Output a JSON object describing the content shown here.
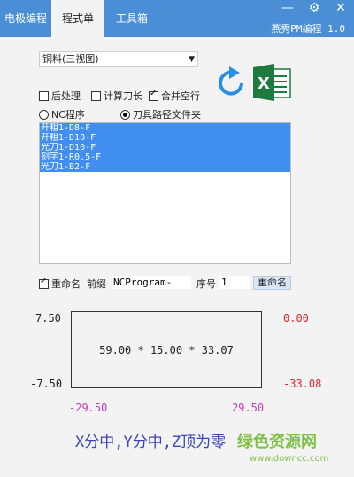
{
  "tabs": [
    "电极编程",
    "程式单",
    "工具箱"
  ],
  "app_title": "燕秀PM编程 1.0",
  "window_controls": [
    "—",
    "⚙",
    "✕"
  ],
  "select_value": "铜料(三视图)",
  "options": {
    "post_process": "后处理",
    "calc_tool_length": "计算刀长",
    "merge_blank_lines": "合并空行",
    "nc_program": "NC程序",
    "tool_path_folder": "刀具路径文件夹"
  },
  "file_list": [
    "开粗1-D8-F",
    "开粗1-D10-F",
    "光刀1-D10-F",
    "刻字1-R0.5-F",
    "光刀1-B2-F"
  ],
  "rename": {
    "checkbox_label": "重命名",
    "prefix_label": "前缀",
    "prefix_value": "NCProgram-",
    "seq_label": "序号",
    "seq_value": "1",
    "button_label": "重命名"
  },
  "dims": {
    "size_text": "59.00 * 15.00 * 33.07",
    "y_max": "7.50",
    "y_min": "-7.50",
    "x_min": "-29.50",
    "x_max": "29.50",
    "z_top": "0.00",
    "z_bottom": "-33.08"
  },
  "colors": {
    "z_values": "#e0262b",
    "x_values": "#c43bc4",
    "y_values": "#222222",
    "instruction": "#3c44b8",
    "titlebar": "#4a8fd6",
    "selection": "#3f8ef0"
  },
  "instruction": "X分中,Y分中,Z顶为零",
  "watermark": {
    "brand": "绿色资源网",
    "url": "www.downcc.com"
  }
}
